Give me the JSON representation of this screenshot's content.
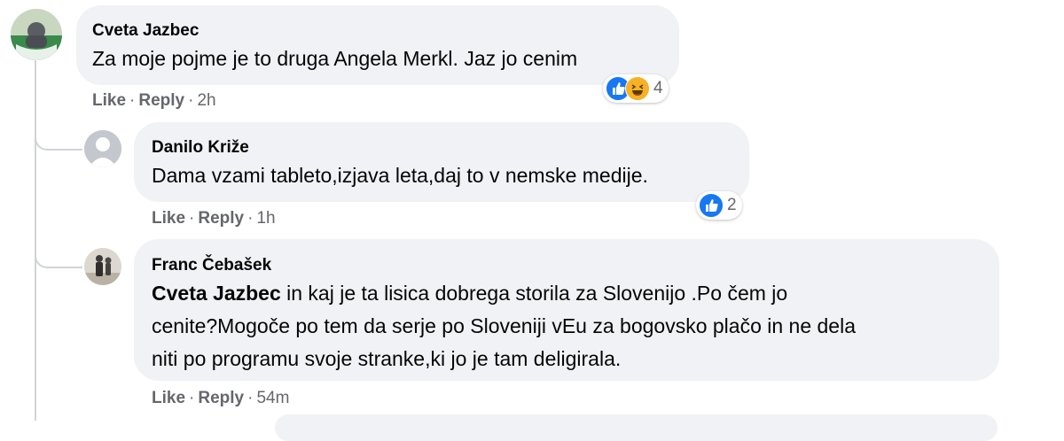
{
  "comments": [
    {
      "author": "Cveta Jazbec",
      "text": "Za moje pojme je to druga Angela Merkl. Jaz jo cenim",
      "actions": {
        "like": "Like",
        "reply": "Reply",
        "time": "2h"
      },
      "reactions": {
        "count": "4",
        "icons": [
          "like-icon",
          "haha-icon"
        ]
      }
    },
    {
      "author": "Danilo Križe",
      "text": "Dama vzami tableto,izjava leta,daj to v nemske medije.",
      "actions": {
        "like": "Like",
        "reply": "Reply",
        "time": "1h"
      },
      "reactions": {
        "count": "2",
        "icons": [
          "like-icon"
        ]
      }
    },
    {
      "author": "Franc Čebašek",
      "mention": "Cveta Jazbec",
      "text_line1": " in kaj je ta lisica dobrega storila za Slovenijo .Po čem jo",
      "text_line2": "cenite?Mogoče po tem da serje po Sloveniji vEu za bogovsko plačo in ne dela",
      "text_line3": "niti po programu svoje stranke,ki jo je tam deligirala.",
      "actions": {
        "like": "Like",
        "reply": "Reply",
        "time": "54m"
      }
    }
  ],
  "separator": "·",
  "colors": {
    "bubble": "#f0f2f5",
    "meta": "#65676b",
    "like": "#1877f2",
    "haha": "#f7b125"
  }
}
